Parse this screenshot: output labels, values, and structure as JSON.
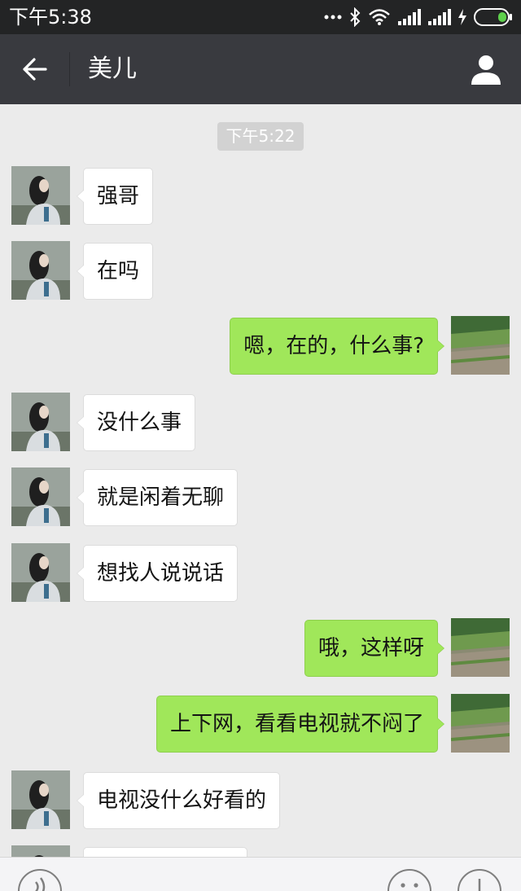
{
  "status_bar": {
    "time": "下午5:38"
  },
  "header": {
    "title": "美儿",
    "back_icon": "arrow-left-icon",
    "profile_icon": "person-icon"
  },
  "chat": {
    "timestamp": "下午5:22",
    "messages": [
      {
        "from": "other",
        "text": "强哥"
      },
      {
        "from": "other",
        "text": "在吗"
      },
      {
        "from": "me",
        "text": "嗯，在的，什么事?"
      },
      {
        "from": "other",
        "text": "没什么事"
      },
      {
        "from": "other",
        "text": "就是闲着无聊"
      },
      {
        "from": "other",
        "text": "想找人说说话"
      },
      {
        "from": "me",
        "text": "哦，这样呀"
      },
      {
        "from": "me",
        "text": "上下网，看看电视就不闷了"
      },
      {
        "from": "other",
        "text": "电视没什么好看的"
      },
      {
        "from": "other",
        "text": ""
      }
    ]
  },
  "colors": {
    "status_bar_bg": "#232425",
    "title_bar_bg": "#393a3f",
    "chat_bg": "#ebebeb",
    "outgoing_bubble": "#a0e75a",
    "incoming_bubble": "#ffffff",
    "battery_green": "#5ed04c"
  },
  "input_bar": {
    "left_icon": "voice-icon",
    "emoji_icon": "emoji-icon",
    "more_icon": "plus-icon"
  }
}
